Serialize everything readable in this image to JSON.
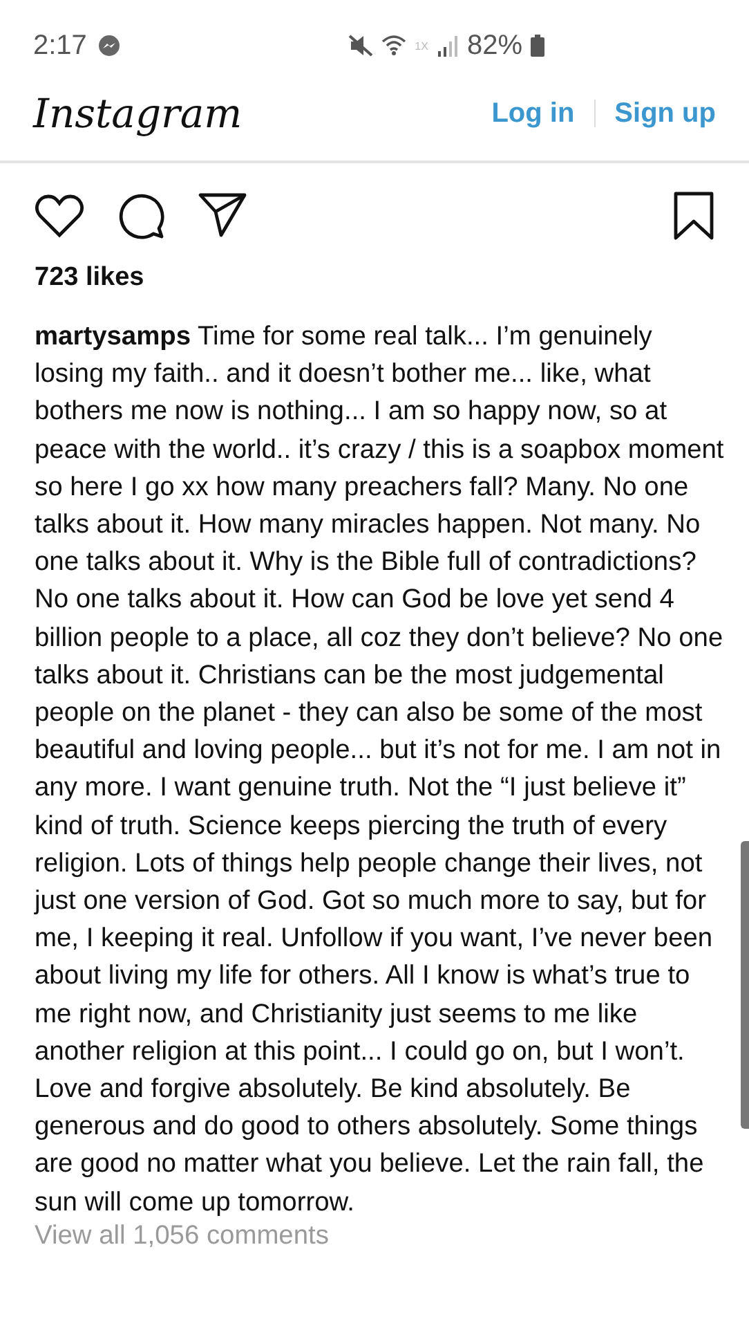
{
  "status_bar": {
    "time": "2:17",
    "network": "1X",
    "battery": "82%"
  },
  "header": {
    "logo": "Instagram",
    "links": [
      {
        "label": "Log in"
      },
      {
        "label": "Sign up"
      }
    ]
  },
  "post": {
    "likes": "723 likes",
    "username": "martysamps",
    "caption": "Time for some real talk... I’m genuinely losing my faith.. and it doesn’t bother me... like, what bothers me now is nothing... I am so happy now, so at peace with the world.. it’s crazy / this is a soapbox moment so here I go xx how many preachers fall? Many. No one talks about it. How many miracles happen. Not many. No one talks about it. Why is the Bible full of contradictions? No one talks about it. How can God be love yet send 4 billion people to a place, all coz they don’t believe? No one talks about it. Christians can be the most judgemental people on the planet - they can also be some of the most beautiful and loving people... but it’s not for me. I am not in any more. I want genuine truth. Not the “I just believe it” kind of truth. Science keeps piercing the truth of every religion. Lots of things help people change their lives, not just one version of God. Got so much more to say, but for me, I keeping it real. Unfollow if you want, I’ve never been about living my life for others. All I know is what’s true to me right now, and Christianity just seems to me like another religion at this point... I could go on, but I won’t. Love and forgive absolutely. Be kind absolutely. Be generous and do good to others absolutely. Some things are good no matter what you believe. Let the rain fall, the sun will come up tomorrow.",
    "comments_link": "View all 1,056 comments"
  }
}
